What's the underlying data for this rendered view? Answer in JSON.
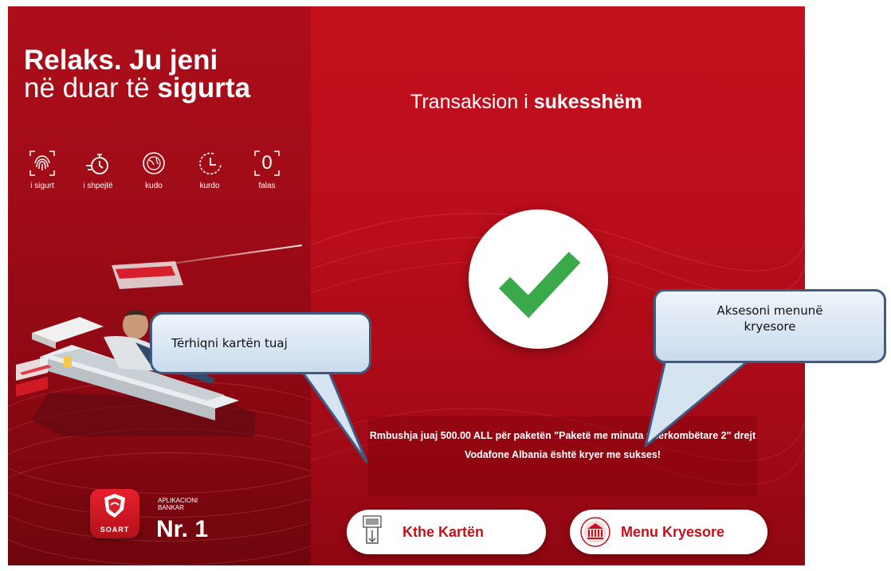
{
  "promo": {
    "headline_line1": "Relaks. Ju jeni",
    "headline_line2_prefix": "në duar të ",
    "headline_line2_emphasis": "sigurta",
    "features": [
      {
        "icon": "fingerprint-icon",
        "label": "i sigurt"
      },
      {
        "icon": "stopwatch-icon",
        "label": "i shpejtë"
      },
      {
        "icon": "globe-icon",
        "label": "kudo"
      },
      {
        "icon": "clock-icon",
        "label": "kurdo"
      },
      {
        "icon": "zero-icon",
        "label": "falas",
        "glyph": "0"
      }
    ],
    "app_logo_text": "SOART",
    "app_caption_line1": "APLIKACIONI",
    "app_caption_line2": "BANKAR",
    "app_rank": "Nr. 1"
  },
  "transaction": {
    "title_prefix": "Transaksion i ",
    "title_emphasis": "sukesshëm",
    "message": "Rmbushja juaj 500.00 ALL për paketën \"Paketë me minuta ndërkombëtare 2\" drejt Vodafone Albania është kryer me sukses!"
  },
  "buttons": {
    "return_card": "Kthe Kartën",
    "main_menu": "Menu Kryesore"
  },
  "callouts": {
    "card": "Tërhiqni kartën tuaj",
    "menu_line1": "Aksesoni menunë",
    "menu_line2": "kryesore"
  },
  "colors": {
    "brand_red": "#c3111d",
    "check_green": "#3aa94a",
    "callout_border": "#3f5b82"
  }
}
